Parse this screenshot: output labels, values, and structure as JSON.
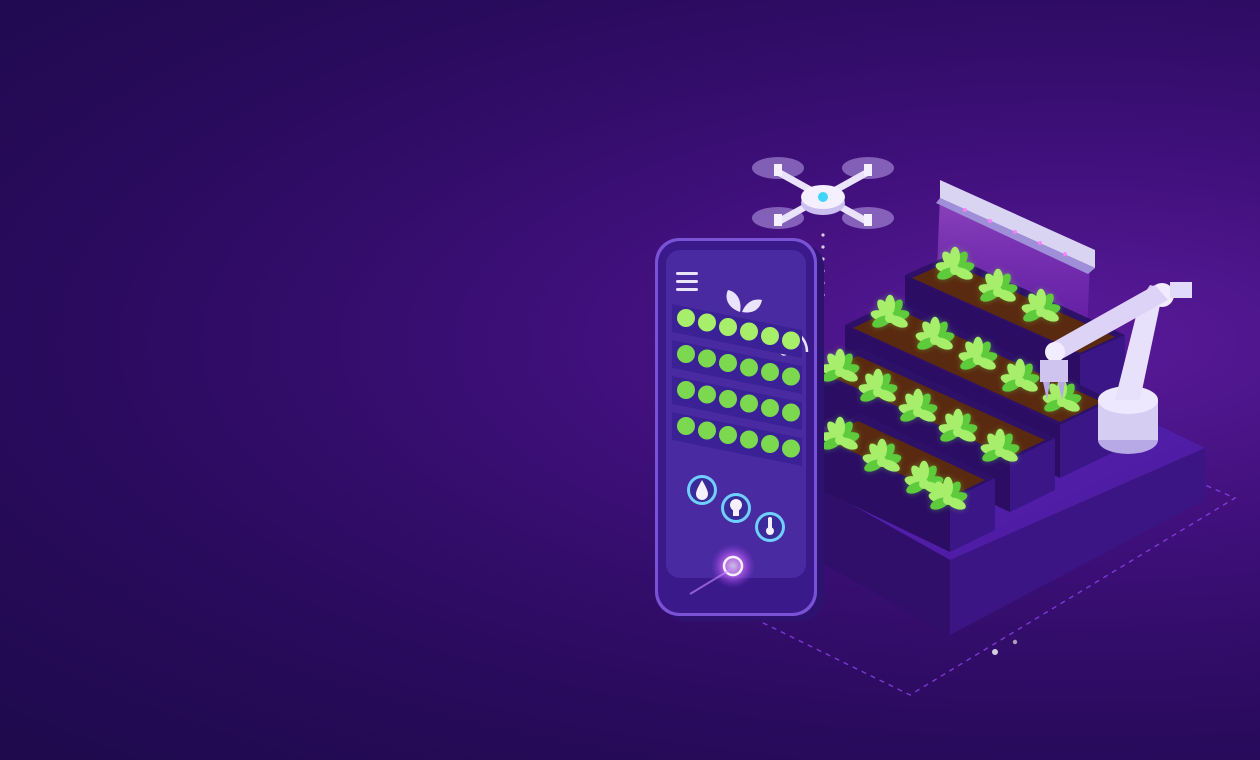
{
  "illustration": {
    "subject": "smart-farming-isometric",
    "colors": {
      "background_dark": "#1e0a4c",
      "background_mid": "#3d0f78",
      "accent_glow": "#c04cff",
      "plant_green": "#5ecb3c",
      "plant_light": "#a7ef6b",
      "soil": "#5a2a10",
      "phone_screen": "#4a2aa0",
      "status_dot": "#7bd84f"
    },
    "phone": {
      "menu_icon": "hamburger-menu-icon",
      "logo_icon": "leaf-logo-icon",
      "signal_icon": "wifi-signal-icon",
      "status_rows": 4,
      "dots_per_row": 6,
      "controls": [
        {
          "icon": "water-drop-icon"
        },
        {
          "icon": "light-bulb-icon"
        },
        {
          "icon": "thermometer-icon"
        }
      ],
      "home_button_icon": "home-button-icon"
    },
    "drone_icon": "drone-icon",
    "robot_arm_icon": "robot-arm-icon",
    "grow_light_icon": "grow-light-icon",
    "planters": 4
  }
}
